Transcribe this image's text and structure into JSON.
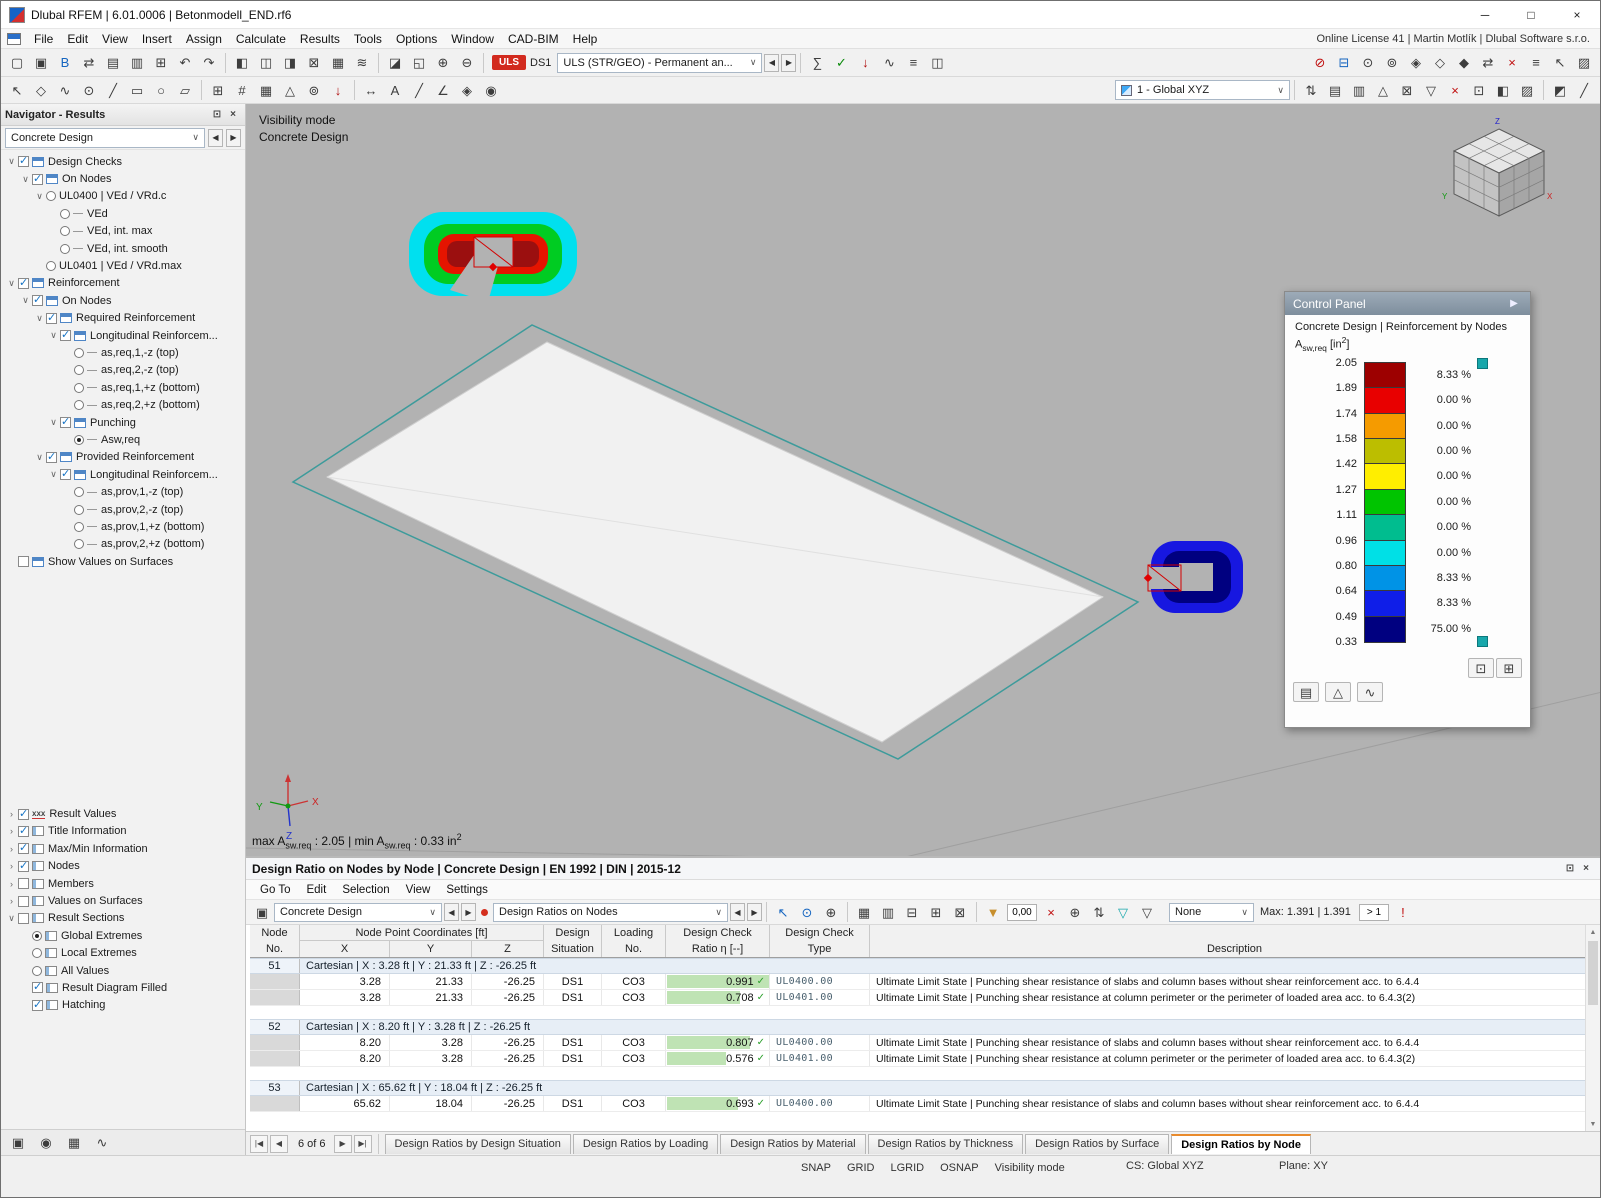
{
  "window": {
    "title": "Dlubal RFEM | 6.01.0006 | Betonmodell_END.rf6",
    "license": "Online License 41 | Martin Motlík | Dlubal Software s.r.o."
  },
  "ui": {
    "chev": "∨",
    "left": "◀",
    "right": "▶",
    "pin": "⊡",
    "close": "×",
    "min": "─",
    "max": "□",
    "check": "✓",
    "tab_first": "|◀",
    "tab_prev": "◀",
    "tab_next": "▶",
    "tab_last": "▶|",
    "up": "▲",
    "down": "▼"
  },
  "menus": [
    "File",
    "Edit",
    "View",
    "Insert",
    "Assign",
    "Calculate",
    "Results",
    "Tools",
    "Options",
    "Window",
    "CAD-BIM",
    "Help"
  ],
  "toolbar1": {
    "g1": [
      {
        "n": "new-model-button",
        "g": "▢"
      },
      {
        "n": "open-file-button",
        "g": "▣"
      },
      {
        "n": "bim-link-button",
        "g": "B",
        "fg": "#1565c0"
      },
      {
        "n": "sync-button",
        "g": "⇄"
      },
      {
        "n": "save-button",
        "g": "▤"
      },
      {
        "n": "print-button",
        "g": "▥"
      },
      {
        "n": "copy-button",
        "g": "⊞"
      },
      {
        "n": "undo-button",
        "g": "↶"
      },
      {
        "n": "redo-button",
        "g": "↷"
      }
    ],
    "g2": [
      {
        "n": "table-dock-left-button",
        "g": "◧"
      },
      {
        "n": "table-dock-both-button",
        "g": "◫"
      },
      {
        "n": "table-dock-right-button",
        "g": "◨"
      },
      {
        "n": "table-export-button",
        "g": "⊠"
      },
      {
        "n": "table-layout-button",
        "g": "▦"
      },
      {
        "n": "table-flow-button",
        "g": "≋"
      }
    ],
    "g3": [
      {
        "n": "render-mode-button",
        "g": "◪"
      },
      {
        "n": "zoom-window-button",
        "g": "◱"
      },
      {
        "n": "zoom-in-button",
        "g": "⊕"
      },
      {
        "n": "zoom-out-button",
        "g": "⊖"
      }
    ],
    "uls_badge": "ULS",
    "ds_label": "DS1",
    "combo": "ULS (STR/GEO) - Permanent an...",
    "g4": [
      {
        "n": "calculate-all-button",
        "g": "∑"
      },
      {
        "n": "check-model-button",
        "g": "✓",
        "fg": "#0a8a0a"
      },
      {
        "n": "show-loads-button",
        "g": "↓",
        "fg": "#b01010"
      },
      {
        "n": "show-results-button",
        "g": "∿"
      },
      {
        "n": "result-values-button",
        "g": "≡"
      },
      {
        "n": "panel-toggle-button",
        "g": "◫"
      }
    ],
    "g5": [
      {
        "n": "stop-button",
        "g": "⊘",
        "fg": "#c01010"
      },
      {
        "n": "print-graphic-button",
        "g": "⊟",
        "fg": "#1565c0"
      },
      {
        "n": "fit-view-button",
        "g": "⊙"
      },
      {
        "n": "zoom-dynamic-button",
        "g": "⊚"
      },
      {
        "n": "view-x-button",
        "g": "◈"
      },
      {
        "n": "view-y-button",
        "g": "◇"
      },
      {
        "n": "view-isometric-button",
        "g": "◆"
      },
      {
        "n": "mirror-view-button",
        "g": "⇄"
      },
      {
        "n": "cancel-mode-button",
        "g": "×",
        "fg": "#c01010"
      },
      {
        "n": "display-settings-button",
        "g": "≡"
      },
      {
        "n": "previous-view-button",
        "g": "↖"
      },
      {
        "n": "render-options-button",
        "g": "▨"
      }
    ]
  },
  "toolbar2": {
    "g1": [
      {
        "n": "select-arrow-button",
        "g": "↖"
      },
      {
        "n": "select-special-button",
        "g": "◇"
      },
      {
        "n": "draw-line-button",
        "g": "∿"
      },
      {
        "n": "insert-node-button",
        "g": "⊙"
      },
      {
        "n": "insert-line-button",
        "g": "╱"
      },
      {
        "n": "insert-rectangle-button",
        "g": "▭"
      },
      {
        "n": "insert-circle-button",
        "g": "○"
      },
      {
        "n": "insert-surface-button",
        "g": "▱"
      }
    ],
    "g2": [
      {
        "n": "generate-button",
        "g": "⊞"
      },
      {
        "n": "mesh-button",
        "g": "#"
      },
      {
        "n": "mesh-refine-button",
        "g": "▦"
      },
      {
        "n": "support-button",
        "g": "△"
      },
      {
        "n": "hinge-button",
        "g": "⊚"
      },
      {
        "n": "load-button",
        "g": "↓",
        "fg": "#b01010"
      }
    ],
    "g3": [
      {
        "n": "dimension-button",
        "g": "↔"
      },
      {
        "n": "text-annotation-button",
        "g": "A"
      },
      {
        "n": "guideline-button",
        "g": "╱"
      },
      {
        "n": "section-button",
        "g": "∠"
      },
      {
        "n": "isometry-button",
        "g": "◈"
      },
      {
        "n": "visibility-button",
        "g": "◉"
      }
    ],
    "combo": "1 - Global XYZ",
    "g4": [
      {
        "n": "renumber-button",
        "g": "⇅"
      },
      {
        "n": "layers-button",
        "g": "▤"
      },
      {
        "n": "grid-settings-button",
        "g": "▥"
      },
      {
        "n": "rotate-view-button",
        "g": "△"
      },
      {
        "n": "block-button",
        "g": "⊠"
      },
      {
        "n": "filter-view-button",
        "g": "▽"
      },
      {
        "n": "clear-selection-button",
        "g": "×",
        "fg": "#c01010"
      },
      {
        "n": "snap-settings-button",
        "g": "⊡"
      },
      {
        "n": "half-view-button",
        "g": "◧"
      },
      {
        "n": "shade-button",
        "g": "▨"
      }
    ],
    "g5": [
      {
        "n": "display-mode-button",
        "g": "◩"
      },
      {
        "n": "edit-pen-button",
        "g": "╱"
      }
    ]
  },
  "navigator": {
    "title": "Navigator - Results",
    "combo": "Concrete Design",
    "tree": [
      {
        "d": 0,
        "exp": "∨",
        "ctrl": "cb",
        "ic": "tbl",
        "label": "Design Checks"
      },
      {
        "d": 1,
        "exp": "∨",
        "ctrl": "cb",
        "ic": "tbl",
        "label": "On Nodes"
      },
      {
        "d": 2,
        "exp": "∨",
        "ctrl": "rd",
        "ic": "none",
        "label": "UL0400 | VEd / VRd.c"
      },
      {
        "d": 3,
        "exp": "",
        "ctrl": "rd",
        "ic": "dash",
        "label": "VEd"
      },
      {
        "d": 3,
        "exp": "",
        "ctrl": "rd",
        "ic": "dash",
        "label": "VEd, int. max"
      },
      {
        "d": 3,
        "exp": "",
        "ctrl": "rd",
        "ic": "dash",
        "label": "VEd, int. smooth"
      },
      {
        "d": 2,
        "exp": "",
        "ctrl": "rd",
        "ic": "none",
        "label": "UL0401 | VEd / VRd.max"
      },
      {
        "d": 0,
        "exp": "∨",
        "ctrl": "cb",
        "ic": "tbl",
        "label": "Reinforcement"
      },
      {
        "d": 1,
        "exp": "∨",
        "ctrl": "cb",
        "ic": "tbl",
        "label": "On Nodes"
      },
      {
        "d": 2,
        "exp": "∨",
        "ctrl": "cb",
        "ic": "tbl",
        "label": "Required Reinforcement"
      },
      {
        "d": 3,
        "exp": "∨",
        "ctrl": "cb",
        "ic": "tbl",
        "label": "Longitudinal Reinforcem..."
      },
      {
        "d": 4,
        "exp": "",
        "ctrl": "rd",
        "ic": "dash",
        "label": "as,req,1,-z (top)"
      },
      {
        "d": 4,
        "exp": "",
        "ctrl": "rd",
        "ic": "dash",
        "label": "as,req,2,-z (top)"
      },
      {
        "d": 4,
        "exp": "",
        "ctrl": "rd",
        "ic": "dash",
        "label": "as,req,1,+z (bottom)"
      },
      {
        "d": 4,
        "exp": "",
        "ctrl": "rd",
        "ic": "dash",
        "label": "as,req,2,+z (bottom)"
      },
      {
        "d": 3,
        "exp": "∨",
        "ctrl": "cb",
        "ic": "tbl",
        "label": "Punching"
      },
      {
        "d": 4,
        "exp": "",
        "ctrl": "rd on",
        "ic": "dash",
        "label": "Asw,req"
      },
      {
        "d": 2,
        "exp": "∨",
        "ctrl": "cb",
        "ic": "tbl",
        "label": "Provided Reinforcement"
      },
      {
        "d": 3,
        "exp": "∨",
        "ctrl": "cb",
        "ic": "tbl",
        "label": "Longitudinal Reinforcem..."
      },
      {
        "d": 4,
        "exp": "",
        "ctrl": "rd",
        "ic": "dash",
        "label": "as,prov,1,-z (top)"
      },
      {
        "d": 4,
        "exp": "",
        "ctrl": "rd",
        "ic": "dash",
        "label": "as,prov,2,-z (top)"
      },
      {
        "d": 4,
        "exp": "",
        "ctrl": "rd",
        "ic": "dash",
        "label": "as,prov,1,+z (bottom)"
      },
      {
        "d": 4,
        "exp": "",
        "ctrl": "rd",
        "ic": "dash",
        "label": "as,prov,2,+z (bottom)"
      },
      {
        "d": 0,
        "exp": "",
        "ctrl": "cb off",
        "ic": "tbl",
        "label": "Show Values on Surfaces"
      }
    ],
    "tree2": [
      {
        "d": 0,
        "exp": "›",
        "ctrl": "cb",
        "ic": "xxx",
        "label": "Result Values"
      },
      {
        "d": 0,
        "exp": "›",
        "ctrl": "cb",
        "ic": "chart",
        "label": "Title Information"
      },
      {
        "d": 0,
        "exp": "›",
        "ctrl": "cb",
        "ic": "chart",
        "label": "Max/Min Information"
      },
      {
        "d": 0,
        "exp": "›",
        "ctrl": "cb",
        "ic": "chart",
        "label": "Nodes"
      },
      {
        "d": 0,
        "exp": "›",
        "ctrl": "cb off",
        "ic": "chart",
        "label": "Members"
      },
      {
        "d": 0,
        "exp": "›",
        "ctrl": "cb off",
        "ic": "chart",
        "label": "Values on Surfaces"
      },
      {
        "d": 0,
        "exp": "∨",
        "ctrl": "cb off",
        "ic": "chart",
        "label": "Result Sections"
      },
      {
        "d": 1,
        "exp": "",
        "ctrl": "rd on",
        "ic": "chart",
        "label": "Global Extremes"
      },
      {
        "d": 1,
        "exp": "",
        "ctrl": "rd",
        "ic": "chart",
        "label": "Local Extremes"
      },
      {
        "d": 1,
        "exp": "",
        "ctrl": "rd",
        "ic": "chart",
        "label": "All Values"
      },
      {
        "d": 1,
        "exp": "",
        "ctrl": "cb",
        "ic": "chart",
        "label": "Result Diagram Filled"
      },
      {
        "d": 1,
        "exp": "",
        "ctrl": "cb",
        "ic": "chart",
        "label": "Hatching"
      }
    ],
    "footer_icons": [
      {
        "n": "display-properties-button",
        "g": "▣"
      },
      {
        "n": "visibility-modes-button",
        "g": "◉"
      },
      {
        "n": "camera-views-button",
        "g": "▦"
      },
      {
        "n": "result-diagram-button",
        "g": "∿"
      }
    ]
  },
  "viewport": {
    "mode1": "Visibility mode",
    "mode2": "Concrete Design",
    "maxmin": {
      "m1": "max A",
      "m2": "sw.req",
      "m3": " : 2.05 | min A",
      "m4": "sw.req",
      "m5": " : 0.33 in",
      "m6": "2"
    },
    "axis": {
      "x": "X",
      "y": "Y",
      "z": "Z"
    }
  },
  "panel": {
    "title": "Control Panel",
    "subtitle": "Concrete Design | Reinforcement by Nodes",
    "u1": "A",
    "u2": "sw,req",
    "u3": " [in",
    "u4": "2",
    "u5": "]",
    "rows": [
      {
        "label": "2.05",
        "color": "#9d0000",
        "pct": "8.33 %"
      },
      {
        "label": "1.89",
        "color": "#e80000",
        "pct": "0.00 %"
      },
      {
        "label": "1.74",
        "color": "#f59b00",
        "pct": "0.00 %"
      },
      {
        "label": "1.58",
        "color": "#bcbe00",
        "pct": "0.00 %"
      },
      {
        "label": "1.42",
        "color": "#ffee00",
        "pct": "0.00 %"
      },
      {
        "label": "1.27",
        "color": "#00c400",
        "pct": "0.00 %"
      },
      {
        "label": "1.11",
        "color": "#00bd8f",
        "pct": "0.00 %"
      },
      {
        "label": "0.96",
        "color": "#00e0e6",
        "pct": "0.00 %"
      },
      {
        "label": "0.80",
        "color": "#0093e6",
        "pct": "8.33 %"
      },
      {
        "label": "0.64",
        "color": "#0f1ee8",
        "pct": "8.33 %"
      },
      {
        "label": "0.49",
        "color": "#000080",
        "pct": "75.00 %"
      }
    ],
    "last_label": "0.33",
    "foot_right": [
      {
        "n": "panel-dock-button",
        "g": "⊡"
      },
      {
        "n": "panel-pages-button",
        "g": "⊞"
      }
    ],
    "foot_left": [
      {
        "n": "color-scale-edit-button",
        "g": "▤"
      },
      {
        "n": "scale-options-button",
        "g": "△"
      },
      {
        "n": "diagram-options-button",
        "g": "∿"
      }
    ]
  },
  "table": {
    "title": "Design Ratio on Nodes by Node | Concrete Design | EN 1992 | DIN | 2015-12",
    "menus": [
      "Go To",
      "Edit",
      "Selection",
      "View",
      "Settings"
    ],
    "combo1": "Concrete Design",
    "combo2": "Design Ratios on Nodes",
    "combo3": "None",
    "filter_value": "0,00",
    "max_label": "Max: 1.391 | 1.391",
    "gt_label": "> 1",
    "tg1": [
      {
        "n": "goto-button",
        "g": "▣"
      }
    ],
    "tg2": [
      {
        "n": "select-in-graphic-button",
        "g": "↖",
        "fg": "#1565c0"
      },
      {
        "n": "sync-selection-button",
        "g": "⊙",
        "fg": "#1565c0"
      },
      {
        "n": "find-values-button",
        "g": "⊕"
      }
    ],
    "tg3": [
      {
        "n": "table-view-button",
        "g": "▦"
      },
      {
        "n": "calendar-view-button",
        "g": "▥"
      },
      {
        "n": "chart-view-button",
        "g": "⊟"
      },
      {
        "n": "print-table-button",
        "g": "⊞"
      },
      {
        "n": "export-table-button",
        "g": "⊠"
      }
    ],
    "tg4": [
      {
        "n": "filter-values-button",
        "g": "▼",
        "fg": "#c78f2d"
      }
    ],
    "tg5": [
      {
        "n": "clear-filter-button",
        "g": "×",
        "fg": "#c01010"
      },
      {
        "n": "zoom-table-button",
        "g": "⊕"
      },
      {
        "n": "sort-button",
        "g": "⇅"
      },
      {
        "n": "filter-teal-button",
        "g": "▽",
        "fg": "#18a7ab"
      },
      {
        "n": "filter-plain-button",
        "g": "▽"
      }
    ],
    "tg6": [
      {
        "n": "critical-filter-button",
        "g": "!",
        "fg": "#c01010"
      }
    ],
    "h": {
      "node1": "Node",
      "node2": "No.",
      "coords": "Node Point Coordinates [ft]",
      "x": "X",
      "y": "Y",
      "z": "Z",
      "sit1": "Design",
      "sit2": "Situation",
      "load1": "Loading",
      "load2": "No.",
      "ratio1": "Design Check",
      "ratio2": "Ratio η [--]",
      "type1": "Design Check",
      "type2": "Type",
      "desc": "Description"
    },
    "groups": [
      {
        "no": "51",
        "header": "Cartesian | X : 3.28 ft | Y : 21.33 ft | Z : -26.25 ft",
        "rows": [
          {
            "x": "3.28",
            "y": "21.33",
            "z": "-26.25",
            "sit": "DS1",
            "load": "CO3",
            "ratio": "0.991",
            "check": "UL0400.00",
            "desc": "Ultimate Limit State | Punching shear resistance of slabs and column bases without shear reinforcement acc. to 6.4.4"
          },
          {
            "x": "3.28",
            "y": "21.33",
            "z": "-26.25",
            "sit": "DS1",
            "load": "CO3",
            "ratio": "0.708",
            "check": "UL0401.00",
            "desc": "Ultimate Limit State | Punching shear resistance at column perimeter or the perimeter of loaded area acc. to 6.4.3(2)"
          }
        ]
      },
      {
        "no": "52",
        "header": "Cartesian | X : 8.20 ft | Y : 3.28 ft | Z : -26.25 ft",
        "rows": [
          {
            "x": "8.20",
            "y": "3.28",
            "z": "-26.25",
            "sit": "DS1",
            "load": "CO3",
            "ratio": "0.807",
            "check": "UL0400.00",
            "desc": "Ultimate Limit State | Punching shear resistance of slabs and column bases without shear reinforcement acc. to 6.4.4"
          },
          {
            "x": "8.20",
            "y": "3.28",
            "z": "-26.25",
            "sit": "DS1",
            "load": "CO3",
            "ratio": "0.576",
            "check": "UL0401.00",
            "desc": "Ultimate Limit State | Punching shear resistance at column perimeter or the perimeter of loaded area acc. to 6.4.3(2)"
          }
        ]
      },
      {
        "no": "53",
        "header": "Cartesian | X : 65.62 ft | Y : 18.04 ft | Z : -26.25 ft",
        "rows": [
          {
            "x": "65.62",
            "y": "18.04",
            "z": "-26.25",
            "sit": "DS1",
            "load": "CO3",
            "ratio": "0.693",
            "check": "UL0400.00",
            "desc": "Ultimate Limit State | Punching shear resistance of slabs and column bases without shear reinforcement acc. to 6.4.4"
          }
        ]
      }
    ],
    "nav_label": "6 of 6",
    "tabs": [
      {
        "label": "Design Ratios by Design Situation"
      },
      {
        "label": "Design Ratios by Loading"
      },
      {
        "label": "Design Ratios by Material"
      },
      {
        "label": "Design Ratios by Thickness"
      },
      {
        "label": "Design Ratios by Surface"
      },
      {
        "label": "Design Ratios by Node",
        "active": true
      }
    ]
  },
  "statusbar": {
    "toggles": [
      "SNAP",
      "GRID",
      "LGRID",
      "OSNAP",
      "Visibility mode"
    ],
    "cs": "CS: Global XYZ",
    "plane": "Plane: XY"
  }
}
